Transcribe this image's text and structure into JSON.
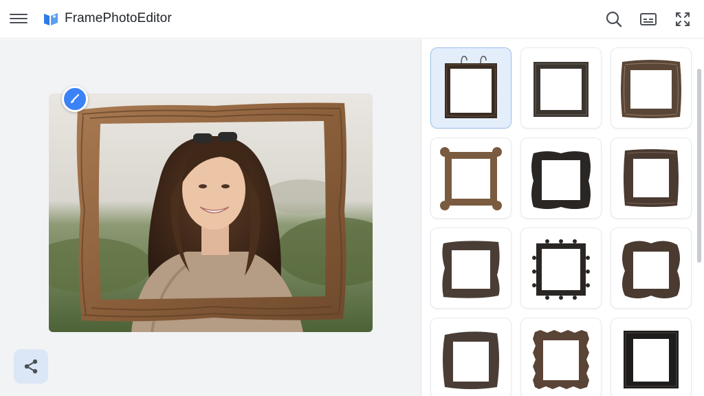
{
  "header": {
    "app_title": "FramePhotoEditor",
    "icons": [
      "menu-icon",
      "app-logo-icon",
      "search-icon",
      "caption-icon",
      "fullscreen-icon"
    ]
  },
  "canvas": {
    "edit_badge_icon": "brush-icon",
    "share_icon": "share-icon"
  },
  "gallery": {
    "selected_index": 0,
    "frames": [
      {
        "style": "hanging-dark-wood",
        "color": "#3a2c22"
      },
      {
        "style": "square-dark",
        "color": "#3b3530"
      },
      {
        "style": "ornate-carved",
        "color": "#5a4636"
      },
      {
        "style": "rounded-corner",
        "color": "#7a5b40"
      },
      {
        "style": "wavy-black",
        "color": "#2a2624"
      },
      {
        "style": "rustic-carved",
        "color": "#4a3a30"
      },
      {
        "style": "driftwood",
        "color": "#4a3d35"
      },
      {
        "style": "studded-black",
        "color": "#2a2624"
      },
      {
        "style": "curvy-dark",
        "color": "#4a3a30"
      },
      {
        "style": "rough-wood",
        "color": "#4a3d35"
      },
      {
        "style": "jagged-brown",
        "color": "#5a4436"
      },
      {
        "style": "thick-black",
        "color": "#1f1d1c"
      }
    ]
  },
  "colors": {
    "accent": "#3b82f6",
    "header_icon": "#4a4f56"
  }
}
